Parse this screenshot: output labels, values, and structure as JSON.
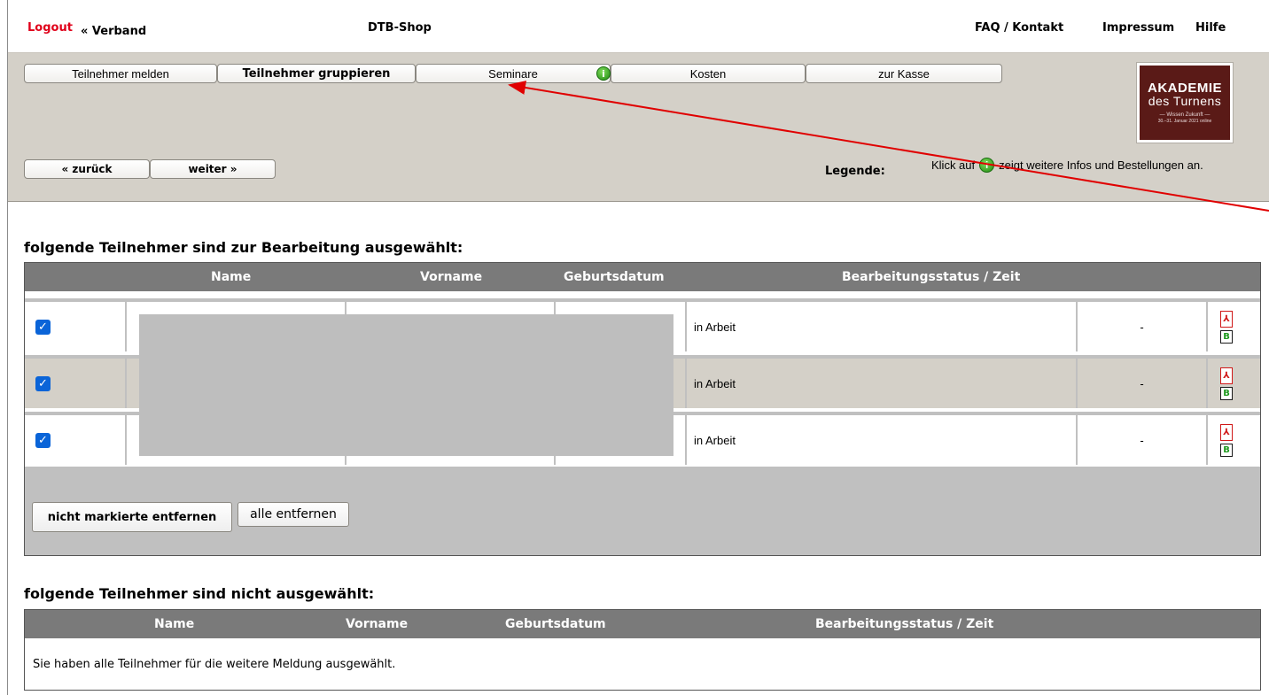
{
  "topbar": {
    "logout": "Logout",
    "verband": "« Verband",
    "title": "DTB-Shop",
    "faq": "FAQ / Kontakt",
    "impressum": "Impressum",
    "hilfe": "Hilfe"
  },
  "toolbar": {
    "tabs": [
      "Teilnehmer melden",
      "Teilnehmer gruppieren",
      "Seminare",
      "Kosten",
      "zur Kasse"
    ],
    "back": "« zurück",
    "next": "weiter »",
    "info_glyph": "i"
  },
  "logo": {
    "line1": "AKADEMIE",
    "line2": "des Turnens",
    "line3": "— Wissen Zukunft —",
    "line4": "30.–31. Januar 2021 online"
  },
  "legend": {
    "label": "Legende:",
    "prefix": "Klick auf",
    "suffix": "zeigt weitere Infos und Bestellungen an."
  },
  "selected": {
    "title": "folgende Teilnehmer sind zur Bearbeitung ausgewählt:",
    "columns": [
      "Name",
      "Vorname",
      "Geburtsdatum",
      "Bearbeitungsstatus / Zeit"
    ],
    "rows": [
      {
        "status": "in Arbeit",
        "time": "-",
        "checked": true
      },
      {
        "status": "in Arbeit",
        "time": "-",
        "checked": true
      },
      {
        "status": "in Arbeit",
        "time": "-",
        "checked": true
      }
    ],
    "btn_remove_unmarked": "nicht markierte entfernen",
    "btn_remove_all": "alle entfernen"
  },
  "unselected": {
    "title": "folgende Teilnehmer sind nicht ausgewählt:",
    "columns": [
      "Name",
      "Vorname",
      "Geburtsdatum",
      "Bearbeitungsstatus / Zeit"
    ],
    "message": "Sie haben alle Teilnehmer für die weitere Meldung ausgewählt."
  },
  "colors": {
    "accent_red": "#e0001a",
    "toolbar_bg": "#d4d0c8",
    "header_gray": "#7a7a7a",
    "logo_bg": "#5a1a17"
  }
}
